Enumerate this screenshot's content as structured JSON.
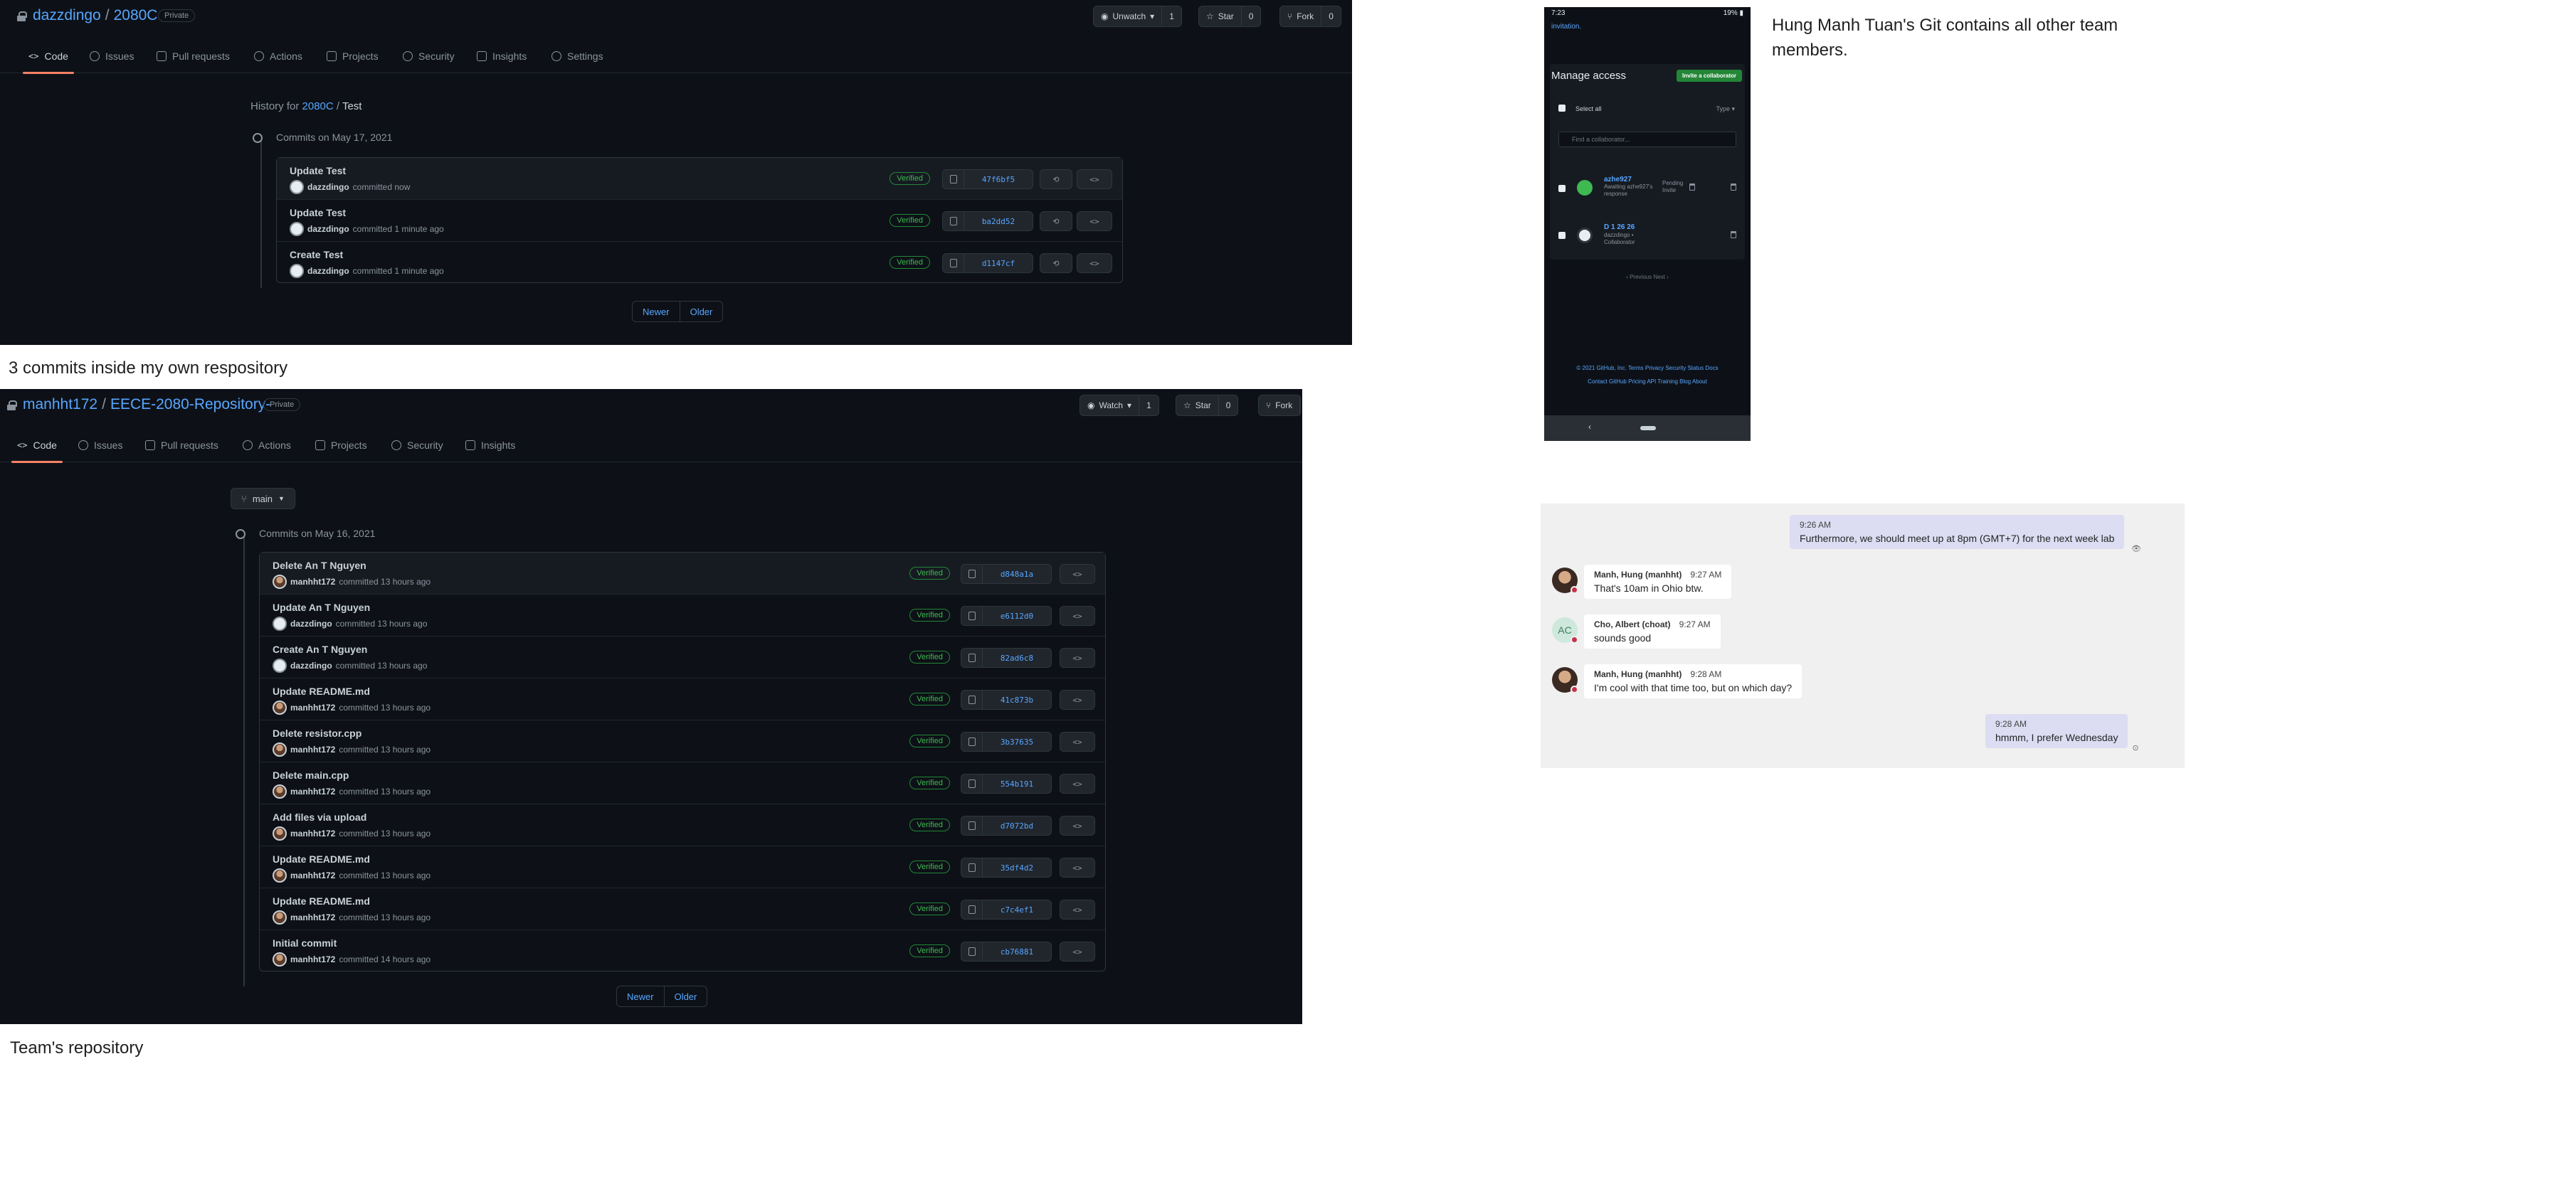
{
  "panel1": {
    "owner": "dazzdingo",
    "repo": "2080C",
    "visibility": "Private",
    "watch": {
      "label": "Unwatch",
      "count": "1"
    },
    "star": {
      "label": "Star",
      "count": "0"
    },
    "fork": {
      "label": "Fork",
      "count": "0"
    },
    "tabs": [
      "Code",
      "Issues",
      "Pull requests",
      "Actions",
      "Projects",
      "Security",
      "Insights",
      "Settings"
    ],
    "history": {
      "prefix": "History for",
      "repo": "2080C",
      "sep": "/",
      "path": "Test"
    },
    "commits_date": "Commits on May 17, 2021",
    "commits": [
      {
        "message": "Update Test",
        "author": "dazzdingo",
        "time": "committed now",
        "verified": "Verified",
        "sha": "47f6bf5"
      },
      {
        "message": "Update Test",
        "author": "dazzdingo",
        "time": "committed 1 minute ago",
        "verified": "Verified",
        "sha": "ba2dd52"
      },
      {
        "message": "Create Test",
        "author": "dazzdingo",
        "time": "committed 1 minute ago",
        "verified": "Verified",
        "sha": "d1147cf"
      }
    ],
    "pager": {
      "newer": "Newer",
      "older": "Older"
    }
  },
  "caption1": "3 commits inside my own respository",
  "panel2": {
    "owner": "manhht172",
    "repo": "EECE-2080-Repository-",
    "visibility": "Private",
    "watch": {
      "label": "Watch",
      "count": "1"
    },
    "star": {
      "label": "Star",
      "count": "0"
    },
    "fork": {
      "label": "Fork",
      "count": ""
    },
    "tabs": [
      "Code",
      "Issues",
      "Pull requests",
      "Actions",
      "Projects",
      "Security",
      "Insights"
    ],
    "branch": "main",
    "commits_date": "Commits on May 16, 2021",
    "commits": [
      {
        "message": "Delete An T Nguyen",
        "author": "manhht172",
        "time": "committed 13 hours ago",
        "verified": "Verified",
        "sha": "d848a1a"
      },
      {
        "message": "Update An T Nguyen",
        "author": "dazzdingo",
        "time": "committed 13 hours ago",
        "verified": "Verified",
        "sha": "e6112d0"
      },
      {
        "message": "Create An T Nguyen",
        "author": "dazzdingo",
        "time": "committed 13 hours ago",
        "verified": "Verified",
        "sha": "82ad6c8"
      },
      {
        "message": "Update README.md",
        "author": "manhht172",
        "time": "committed 13 hours ago",
        "verified": "Verified",
        "sha": "41c873b"
      },
      {
        "message": "Delete resistor.cpp",
        "author": "manhht172",
        "time": "committed 13 hours ago",
        "verified": "Verified",
        "sha": "3b37635"
      },
      {
        "message": "Delete main.cpp",
        "author": "manhht172",
        "time": "committed 13 hours ago",
        "verified": "Verified",
        "sha": "554b191"
      },
      {
        "message": "Add files via upload",
        "author": "manhht172",
        "time": "committed 13 hours ago",
        "verified": "Verified",
        "sha": "d7072bd"
      },
      {
        "message": "Update README.md",
        "author": "manhht172",
        "time": "committed 13 hours ago",
        "verified": "Verified",
        "sha": "35df4d2"
      },
      {
        "message": "Update README.md",
        "author": "manhht172",
        "time": "committed 13 hours ago",
        "verified": "Verified",
        "sha": "c7c4ef1"
      },
      {
        "message": "Initial commit",
        "author": "manhht172",
        "time": "committed 14 hours ago",
        "verified": "Verified",
        "sha": "cb76881"
      }
    ],
    "pager": {
      "newer": "Newer",
      "older": "Older"
    }
  },
  "caption2": "Team's repository",
  "phone": {
    "time": "7:23",
    "status_right": "19% ▮",
    "invitation": "invitation.",
    "title": "Manage access",
    "invite_button": "Invite a collaborator",
    "select_all": "Select all",
    "type_filter": "Type ▾",
    "find_placeholder": "Find a collaborator...",
    "collaborators": [
      {
        "name": "azhe927",
        "sub": "Awaiting azhe927's response",
        "extra": "Pending Invite"
      },
      {
        "name": "D 1 26 26",
        "sub": "dazzdingo • Collaborator",
        "extra": ""
      }
    ],
    "pagination": "‹ Previous    Next ›",
    "footer1": "© 2021 GitHub, Inc.   Terms   Privacy   Security   Status   Docs",
    "footer2": "Contact GitHub   Pricing   API   Training   Blog   About",
    "nav_back": "‹"
  },
  "side_note": "Hung Manh Tuan's Git contains all other team members.",
  "chat": {
    "messages": [
      {
        "kind": "mine",
        "time": "9:26 AM",
        "text": "Furthermore, we should meet up at  8pm (GMT+7) for the next week lab"
      },
      {
        "kind": "other",
        "name": "Manh, Hung (manhht)",
        "time": "9:27 AM",
        "text": "That's 10am in Ohio btw."
      },
      {
        "kind": "other",
        "name": "Cho, Albert (choat)",
        "time": "9:27 AM",
        "text": "sounds good",
        "initials": "AC"
      },
      {
        "kind": "other",
        "name": "Manh, Hung (manhht)",
        "time": "9:28 AM",
        "text": "I'm cool with that time too, but on which day?"
      },
      {
        "kind": "mine",
        "time": "9:28 AM",
        "text": "hmmm, I prefer Wednesday"
      }
    ]
  },
  "colors": {
    "gh_bg": "#0d1117",
    "gh_link": "#58a6ff",
    "verified": "#3fb950",
    "active_tab": "#f78166",
    "teams_mine": "#dcdcf2"
  }
}
